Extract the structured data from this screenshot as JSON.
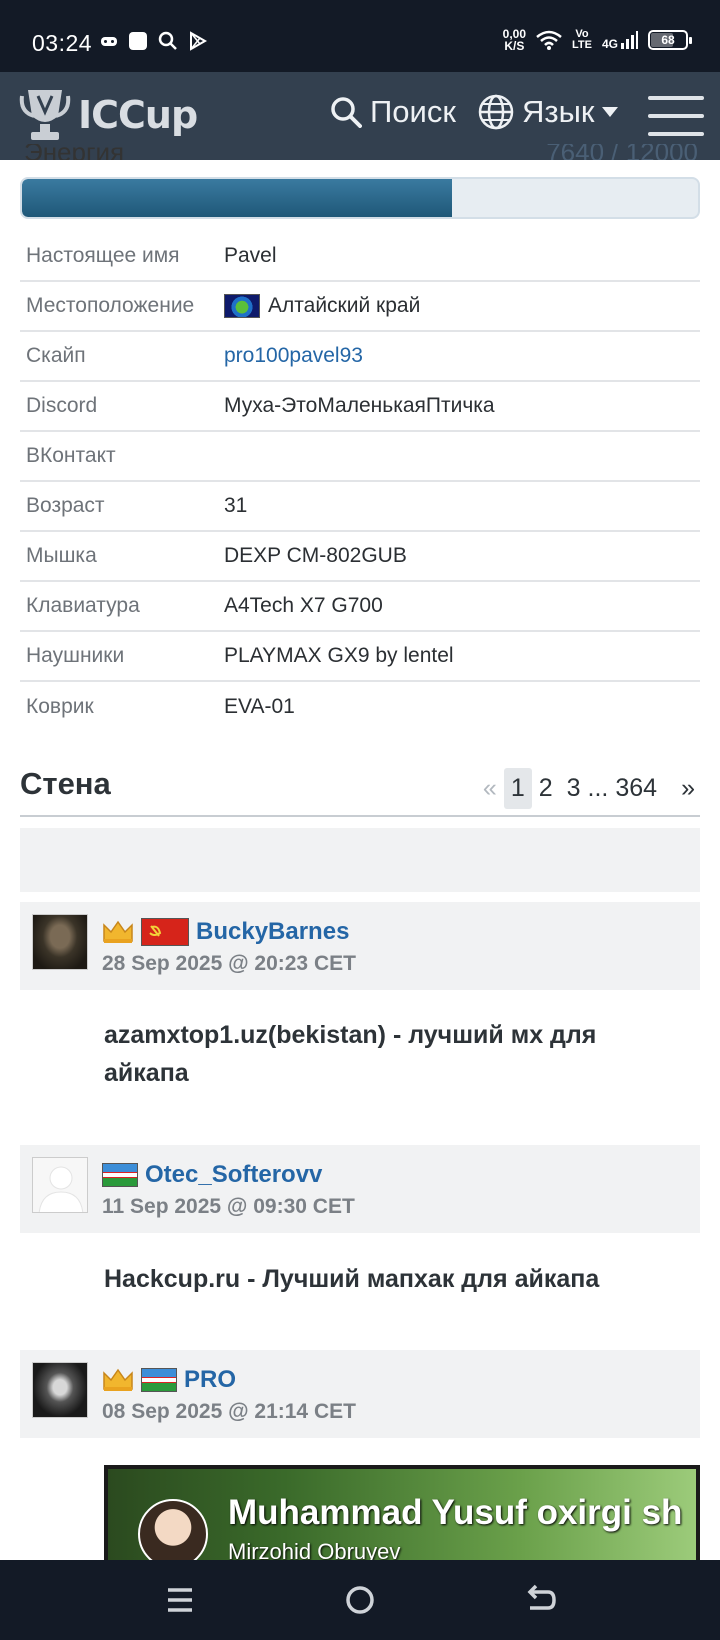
{
  "status_bar": {
    "time": "03:24",
    "speed_value": "0,00",
    "speed_unit": "K/S",
    "volte_top": "Vo",
    "volte_bottom": "LTE",
    "network": "4G",
    "battery": "68"
  },
  "header": {
    "logo": "ICCup",
    "search_label": "Поиск",
    "language_label": "Язык"
  },
  "energy": {
    "label": "Энергия",
    "value": "7640 / 12000",
    "fill_fraction": 0.6367
  },
  "profile": {
    "rows": [
      {
        "key": "Настоящее имя",
        "value": "Pavel"
      },
      {
        "key": "Местоположение",
        "value": "Алтайский край",
        "flag": "globe-flag"
      },
      {
        "key": "Скайп",
        "value": "pro100pavel93",
        "link": true
      },
      {
        "key": "Discord",
        "value": "Муха-ЭтоМаленькаяПтичка"
      },
      {
        "key": "ВКонтакт",
        "value": ""
      },
      {
        "key": "Возраст",
        "value": "31"
      },
      {
        "key": "Мышка",
        "value": "DEXP CM-802GUB"
      },
      {
        "key": "Клавиатура",
        "value": "A4Tech X7 G700"
      },
      {
        "key": "Наушники",
        "value": "PLAYMAX GX9 by lentel"
      },
      {
        "key": "Коврик",
        "value": "EVA-01"
      }
    ]
  },
  "wall": {
    "title": "Стена",
    "pagination": {
      "prev": "«",
      "pages": [
        "1",
        "2",
        "3"
      ],
      "ellipsis": "...",
      "last": "364",
      "next": "»",
      "current": "1"
    },
    "posts": [
      {
        "username": "BuckyBarnes",
        "date": "28 Sep 2025 @ 20:23 CET",
        "text": "azamxtop1.uz(bekistan) - лучший мх для айкапа",
        "badges": [
          "crown-icon",
          "ussr-flag"
        ]
      },
      {
        "username": "Otec_Softerovv",
        "date": "11 Sep 2025 @ 09:30 CET",
        "text": "Hackcup.ru - Лучший мапхак для айкапа",
        "badges": [
          "uzbekistan-flag"
        ]
      },
      {
        "username": "PRO",
        "date": "08 Sep 2025 @ 21:14 CET",
        "text": "",
        "badges": [
          "crown-icon",
          "uzbekistan-flag"
        ],
        "video": {
          "title": "Muhammad Yusuf oxirgi sh",
          "channel": "Mirzohid Obruyev"
        }
      }
    ]
  },
  "colors": {
    "header_bg": "#33404f",
    "link": "#2466a6",
    "energy_fill": "#1f5878",
    "system_bar": "#131a26"
  }
}
